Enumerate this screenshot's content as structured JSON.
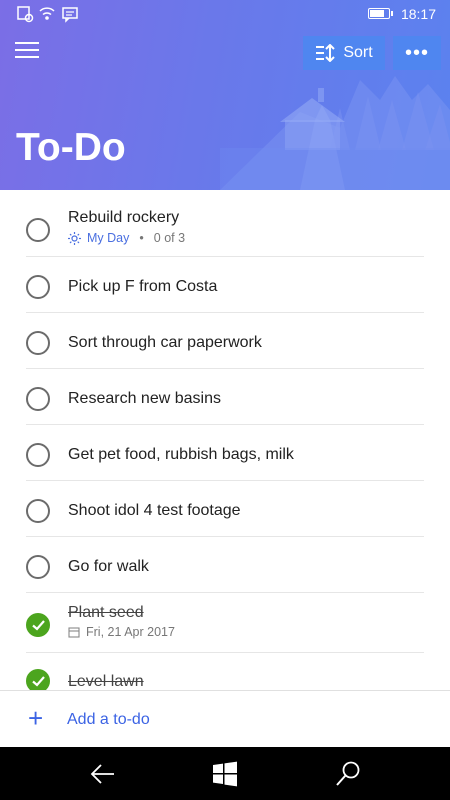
{
  "statusbar": {
    "time": "18:17",
    "battery_level": 0.8,
    "icons": [
      "notification-icon",
      "wifi-icon",
      "message-icon"
    ]
  },
  "header": {
    "title": "To-Do",
    "sort_label": "Sort",
    "more_label": "•••",
    "accent_color": "#4f86f0"
  },
  "tasks": [
    {
      "title": "Rebuild rockery",
      "done": false,
      "meta": {
        "my_day": "My Day",
        "separator": "•",
        "steps": "0 of 3"
      }
    },
    {
      "title": "Pick up F from Costa",
      "done": false
    },
    {
      "title": "Sort through car paperwork",
      "done": false
    },
    {
      "title": "Research new basins",
      "done": false
    },
    {
      "title": "Get pet food, rubbish bags, milk",
      "done": false
    },
    {
      "title": "Shoot idol 4 test footage",
      "done": false
    },
    {
      "title": "Go for walk",
      "done": false
    },
    {
      "title": "Plant seed",
      "done": true,
      "meta": {
        "date": "Fri, 21 Apr 2017"
      }
    },
    {
      "title": "Level lawn",
      "done": true
    }
  ],
  "add_todo": {
    "plus": "+",
    "label": "Add a to-do"
  },
  "navbar": {
    "icons": [
      "back-arrow-icon",
      "windows-icon",
      "search-icon"
    ]
  },
  "colors": {
    "done_green": "#4ca51e",
    "link_blue": "#3b63e4"
  }
}
